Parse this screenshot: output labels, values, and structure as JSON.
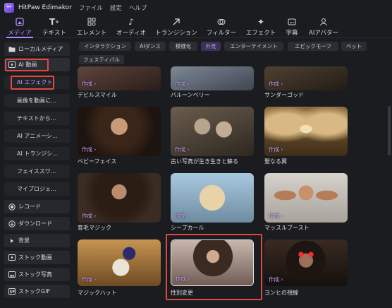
{
  "titlebar": {
    "app_name": "HitPaw Edimakor",
    "menu": [
      "ファイル",
      "設定",
      "ヘルプ"
    ]
  },
  "toolbar": {
    "items": [
      {
        "label": "メディア",
        "icon": "media-icon",
        "active": true
      },
      {
        "label": "テキスト",
        "icon": "text-icon"
      },
      {
        "label": "エレメント",
        "icon": "element-icon"
      },
      {
        "label": "オーディオ",
        "icon": "audio-icon"
      },
      {
        "label": "トランジション",
        "icon": "transition-icon"
      },
      {
        "label": "フィルター",
        "icon": "filter-icon"
      },
      {
        "label": "エフェクト",
        "icon": "effect-icon"
      },
      {
        "label": "字幕",
        "icon": "subtitle-icon"
      },
      {
        "label": "AIアバター",
        "icon": "ai-avatar-icon"
      }
    ]
  },
  "sidebar": {
    "local_media": "ローカルメディア",
    "ai_video": "AI 動画",
    "sub_items": [
      "AI エフェクト",
      "画像を動画に...",
      "テキストから...",
      "AI アニメーシ...",
      "AI トランジシ...",
      "フェイススワ...",
      "マイプロジェ..."
    ],
    "record": "レコード",
    "download": "ダウンロード",
    "background": "背景",
    "stock_video": "ストック動画",
    "stock_photo": "ストック写真",
    "stock_gif": "ストックGIF"
  },
  "filters": {
    "row1": [
      "インタラクション",
      "AIダンス",
      "模様化",
      "外見",
      "エンターテイメント",
      "エピックモーフ",
      "ペット"
    ],
    "row2": [
      "フェスティバル"
    ],
    "active": "外見"
  },
  "cards": {
    "make_label": "作成 ›",
    "row0": [
      "デビルスマイル",
      "バルーンベリー",
      "サンダーゴッド"
    ],
    "row1": [
      "ベビーフェイス",
      "古い写真が生き生きと蘇る",
      "聖なる翼"
    ],
    "row2": [
      "育毛マジック",
      "シープカール",
      "マッスルブースト"
    ],
    "row3": [
      "マジックハット",
      "性別変更",
      "ヨンヒの視線"
    ]
  },
  "colors": {
    "accent": "#b58cff",
    "highlight": "#e2483e",
    "background": "#1b1c20"
  }
}
